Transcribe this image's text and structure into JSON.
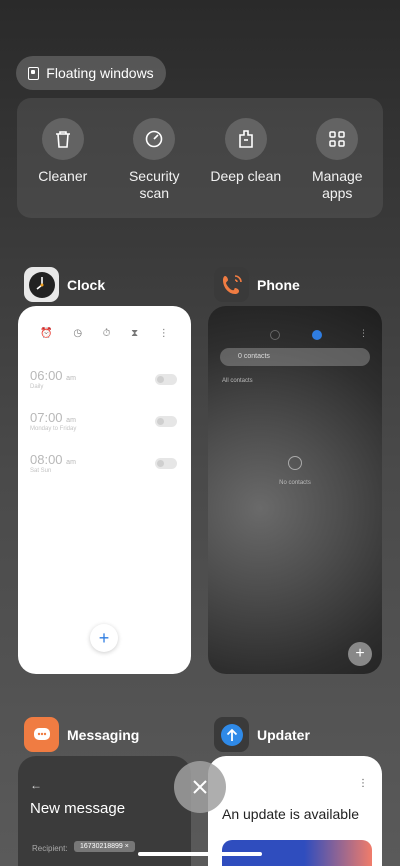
{
  "floating": {
    "label": "Floating windows"
  },
  "quick_actions": [
    {
      "label": "Cleaner",
      "icon": "trash-icon"
    },
    {
      "label": "Security scan",
      "icon": "security-scan-icon"
    },
    {
      "label": "Deep clean",
      "icon": "deep-clean-icon"
    },
    {
      "label": "Manage apps",
      "icon": "grid-icon"
    }
  ],
  "apps": {
    "clock": {
      "title": "Clock",
      "alarms": [
        {
          "time": "06:00",
          "ampm": "am",
          "sub": "Daily"
        },
        {
          "time": "07:00",
          "ampm": "am",
          "sub": "Monday to Friday"
        },
        {
          "time": "08:00",
          "ampm": "am",
          "sub": "Sat Sun"
        }
      ]
    },
    "phone": {
      "title": "Phone",
      "search_placeholder": "0 contacts",
      "meta": "All contacts",
      "empty": "No contacts"
    },
    "messaging": {
      "title": "Messaging",
      "heading": "New message",
      "recipient_label": "Recipient:",
      "recipient_chip": "16730218899"
    },
    "updater": {
      "title": "Updater",
      "message": "An update is available"
    }
  },
  "colors": {
    "accent": "#2f7de1",
    "updater_icon": "#2f8ae8",
    "messaging_icon": "#f07c42",
    "phone_icon": "#f07c42"
  }
}
